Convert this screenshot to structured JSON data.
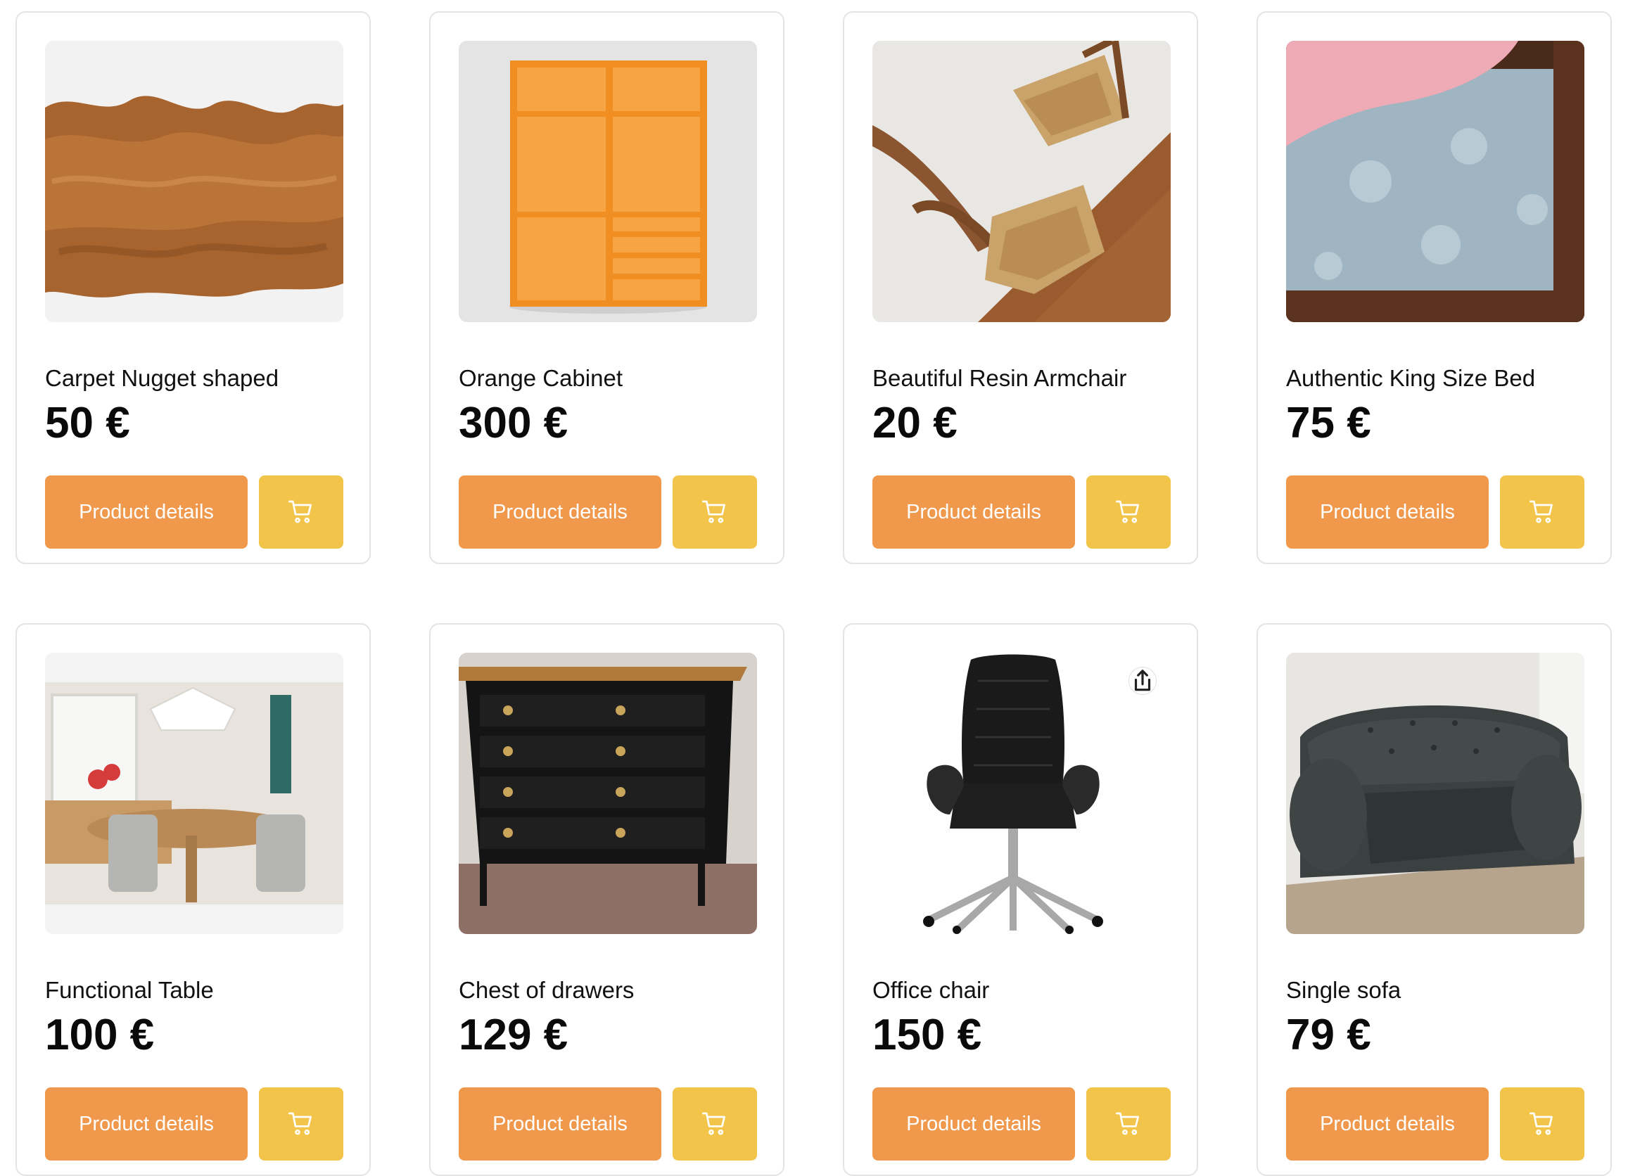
{
  "products": [
    {
      "title": "Carpet Nugget shaped",
      "price": "50 €",
      "details_label": "Product details",
      "image": "fur-rug"
    },
    {
      "title": "Orange Cabinet",
      "price": "300 €",
      "details_label": "Product details",
      "image": "orange-cabinet"
    },
    {
      "title": "Beautiful Resin Armchair",
      "price": "20 €",
      "details_label": "Product details",
      "image": "wooden-chairs"
    },
    {
      "title": "Authentic King Size Bed",
      "price": "75 €",
      "details_label": "Product details",
      "image": "bed-mattress"
    },
    {
      "title": "Functional Table",
      "price": "100 €",
      "details_label": "Product details",
      "image": "dining-room"
    },
    {
      "title": "Chest of drawers",
      "price": "129 €",
      "details_label": "Product details",
      "image": "black-dresser"
    },
    {
      "title": "Office chair",
      "price": "150 €",
      "details_label": "Product details",
      "image": "office-chair"
    },
    {
      "title": "Single sofa",
      "price": "79 €",
      "details_label": "Product details",
      "image": "chesterfield-sofa"
    }
  ],
  "icons": {
    "cart": "shopping-cart-icon",
    "share": "share-icon"
  },
  "colors": {
    "details_button": "#f0994d",
    "cart_button": "#f3c44a",
    "card_border": "#e4e4e7"
  }
}
